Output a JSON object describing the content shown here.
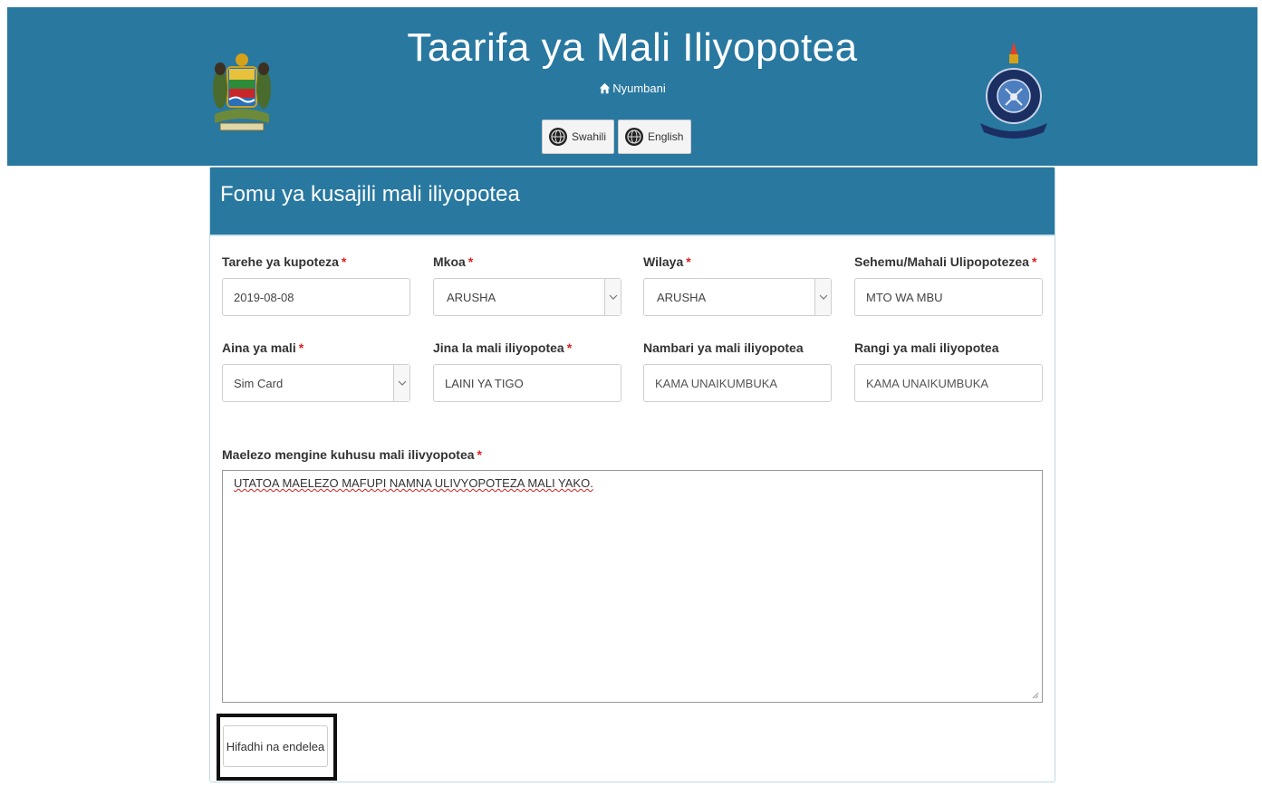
{
  "header": {
    "title": "Taarifa ya Mali Iliyopotea",
    "home_label": "Nyumbani",
    "languages": [
      {
        "label": "Swahili"
      },
      {
        "label": "English"
      }
    ],
    "left_logo": "tanzania-coat-of-arms",
    "right_logo": "tanzania-police-emblem",
    "bg_color": "#2878a0"
  },
  "form": {
    "title": "Fomu ya kusajili mali iliyopotea",
    "required_marker": "*",
    "fields": {
      "date": {
        "label": "Tarehe ya kupoteza",
        "value": "2019-08-08"
      },
      "region": {
        "label": "Mkoa",
        "value": "ARUSHA"
      },
      "district": {
        "label": "Wilaya",
        "value": "ARUSHA"
      },
      "place": {
        "label": "Sehemu/Mahali Ulipopotezea",
        "value": "MTO WA MBU"
      },
      "type": {
        "label": "Aina ya mali",
        "value": "Sim Card"
      },
      "name": {
        "label": "Jina la mali iliyopotea",
        "value": "LAINI YA TIGO"
      },
      "number": {
        "label": "Nambari ya mali iliyopotea",
        "placeholder": "KAMA UNAIKUMBUKA"
      },
      "color": {
        "label": "Rangi ya mali iliyopotea",
        "placeholder": "KAMA UNAIKUMBUKA"
      }
    },
    "description": {
      "label": "Maelezo mengine kuhusu mali ilivyopotea",
      "value": "UTATOA MAELEZO MAFUPI NAMNA ULIVYOPOTEZA MALI YAKO."
    },
    "submit_label": "Hifadhi na endelea"
  }
}
